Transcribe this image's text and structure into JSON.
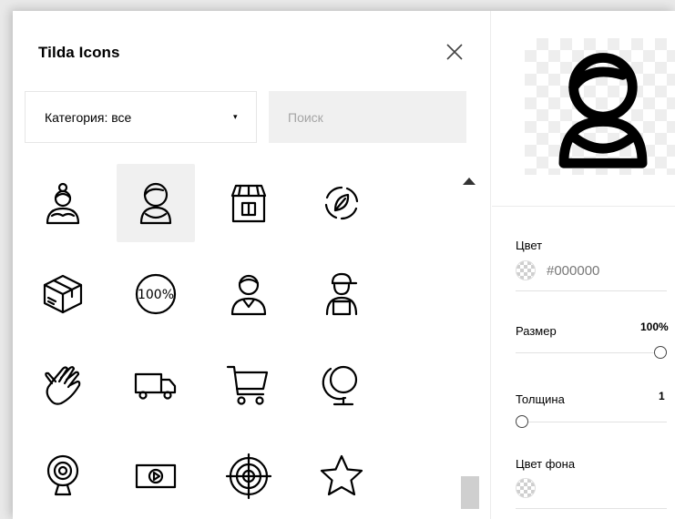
{
  "panel": {
    "title": "Tilda Icons",
    "category_label": "Категория: все",
    "category_arrow": "▾",
    "search_placeholder": "Поиск"
  },
  "icons": [
    {
      "name": "woman-icon",
      "selected": false
    },
    {
      "name": "woman-short-hair-icon",
      "selected": true
    },
    {
      "name": "shop-icon",
      "selected": false
    },
    {
      "name": "eco-leaf-cycle-icon",
      "selected": false
    },
    {
      "name": "package-box-icon",
      "selected": false
    },
    {
      "name": "100-percent-icon",
      "selected": false
    },
    {
      "name": "man-icon",
      "selected": false
    },
    {
      "name": "courier-man-icon",
      "selected": false
    },
    {
      "name": "hand-icon",
      "selected": false
    },
    {
      "name": "delivery-truck-icon",
      "selected": false
    },
    {
      "name": "shopping-cart-icon",
      "selected": false
    },
    {
      "name": "globe-icon",
      "selected": false
    },
    {
      "name": "webcam-icon",
      "selected": false
    },
    {
      "name": "video-play-icon",
      "selected": false
    },
    {
      "name": "target-icon",
      "selected": false
    },
    {
      "name": "star-icon",
      "selected": false
    }
  ],
  "badge_text": "100%",
  "settings": {
    "color": {
      "label": "Цвет",
      "value": "#000000"
    },
    "size": {
      "label": "Размер",
      "value": "100%",
      "level": 1.0
    },
    "thickness": {
      "label": "Толщина",
      "value": "1",
      "level": 0.0
    },
    "bg_color": {
      "label": "Цвет фона"
    }
  }
}
